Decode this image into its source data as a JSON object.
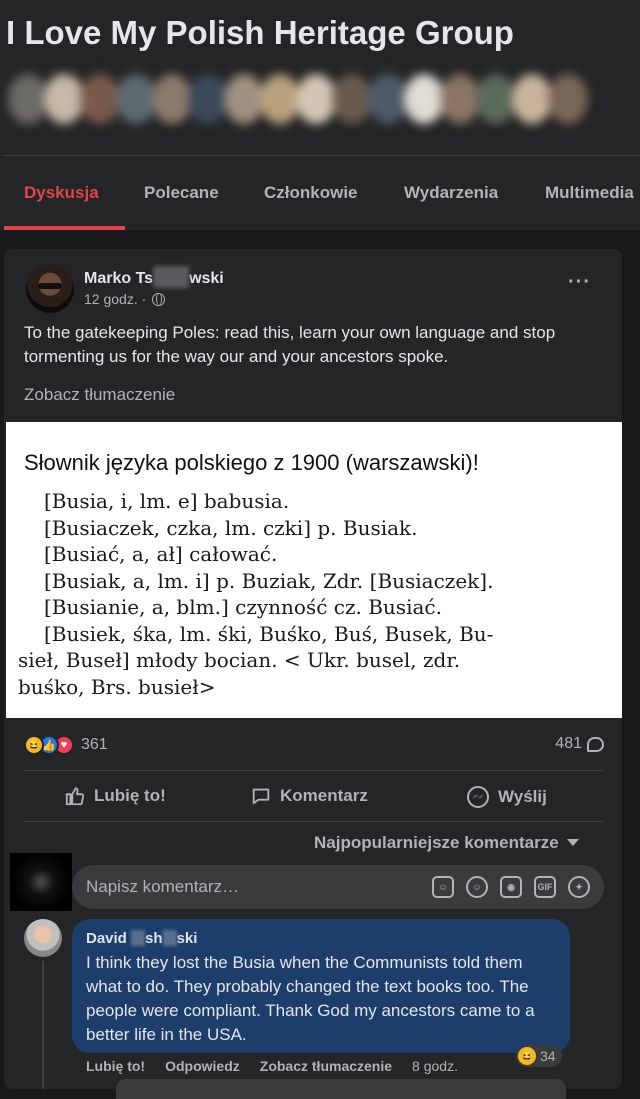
{
  "group": {
    "title": "I Love My Polish Heritage Group",
    "member_colors": [
      "#6c6a66",
      "#c7b8a8",
      "#7a5a4a",
      "#5d6a72",
      "#8c7a6a",
      "#3a4a5a",
      "#a09080",
      "#b8a27c",
      "#d2c6b4",
      "#6a5a4e",
      "#4e5a6a",
      "#e0dcd4",
      "#8a7464",
      "#5a6a5a",
      "#c8b49c",
      "#7a6656"
    ]
  },
  "tabs": [
    {
      "label": "Dyskusja",
      "active": true
    },
    {
      "label": "Polecane",
      "active": false
    },
    {
      "label": "Członkowie",
      "active": false
    },
    {
      "label": "Wydarzenia",
      "active": false
    },
    {
      "label": "Multimedia",
      "active": false
    }
  ],
  "post": {
    "author_first": "Marko Ts",
    "author_last": "wski",
    "time": "12 godz. ·",
    "text": "To the gatekeeping Poles: read this, learn your own language and stop tormenting us for the way our and your ancestors spoke.",
    "translate_label": "Zobacz tłumaczenie",
    "image": {
      "title": "Słownik języka polskiego z 1900 (warszawski)!",
      "lines": [
        "[Busia, i, lm. e] babusia.",
        "[Busiaczek, czka, lm. czki] p. Busiak.",
        "[Busiać, a, ał] całować.",
        "[Busiak, a, lm. i] p. Buziak, Zdr. [Busiaczek].",
        "[Busianie, a, blm.] czynność cz. Busiać.",
        "[Busiek, śka, lm. śki, Buśko, Buś, Busek, Bu-",
        "sieł, Buseł] młody bocian. < Ukr. busel, zdr.",
        "buśko, Brs. busieł>"
      ]
    },
    "reaction_count": "361",
    "comment_count": "481",
    "actions": {
      "like": "Lubię to!",
      "comment": "Komentarz",
      "send": "Wyślij"
    }
  },
  "comments_section": {
    "sort_label": "Najpopularniejsze komentarze",
    "input_placeholder": "Napisz komentarz…",
    "input_icons": [
      "sticker-icon",
      "emoji-icon",
      "camera-icon",
      "gif-icon",
      "avatar-sticker-icon"
    ],
    "gif_label": "GIF"
  },
  "comment": {
    "author_a": "David",
    "author_b": "sh",
    "author_c": "ski",
    "text": "I think they lost the Busia when the Communists told them what to do. They probably changed the text books too. The people were compliant. Thank God my ancestors came to a better life in the USA.",
    "reaction_count": "34",
    "like_label": "Lubię to!",
    "reply_label": "Odpowiedz",
    "translate_label": "Zobacz tłumaczenie",
    "time": "8 godz."
  }
}
